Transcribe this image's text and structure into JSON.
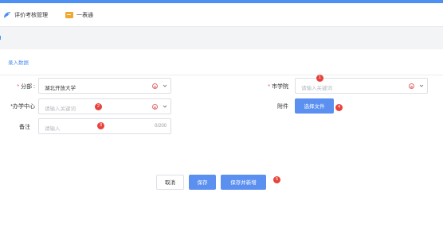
{
  "header": {
    "brand_label": "评价考核管理",
    "apps_label": "一表通"
  },
  "tab": {
    "label": "录入数据"
  },
  "form": {
    "branch": {
      "label": "分部",
      "value": "湖北开放大学"
    },
    "center": {
      "label": "办学中心",
      "placeholder": "请输入关键词"
    },
    "remark": {
      "label": "备注",
      "placeholder": "请输入",
      "counter": "0/200"
    },
    "college": {
      "label": "市学院",
      "placeholder": "请输入关键词"
    },
    "attachment": {
      "label": "附件",
      "button": "选择文件"
    }
  },
  "badges": [
    "1",
    "2",
    "3",
    "4",
    "5"
  ],
  "actions": {
    "cancel": "取消",
    "save": "保存",
    "save_new": "保存并新增"
  },
  "colors": {
    "accent": "#4e8ff2",
    "primary_button": "#5b8ff0",
    "badge": "#e8413a",
    "required": "#e64545"
  }
}
